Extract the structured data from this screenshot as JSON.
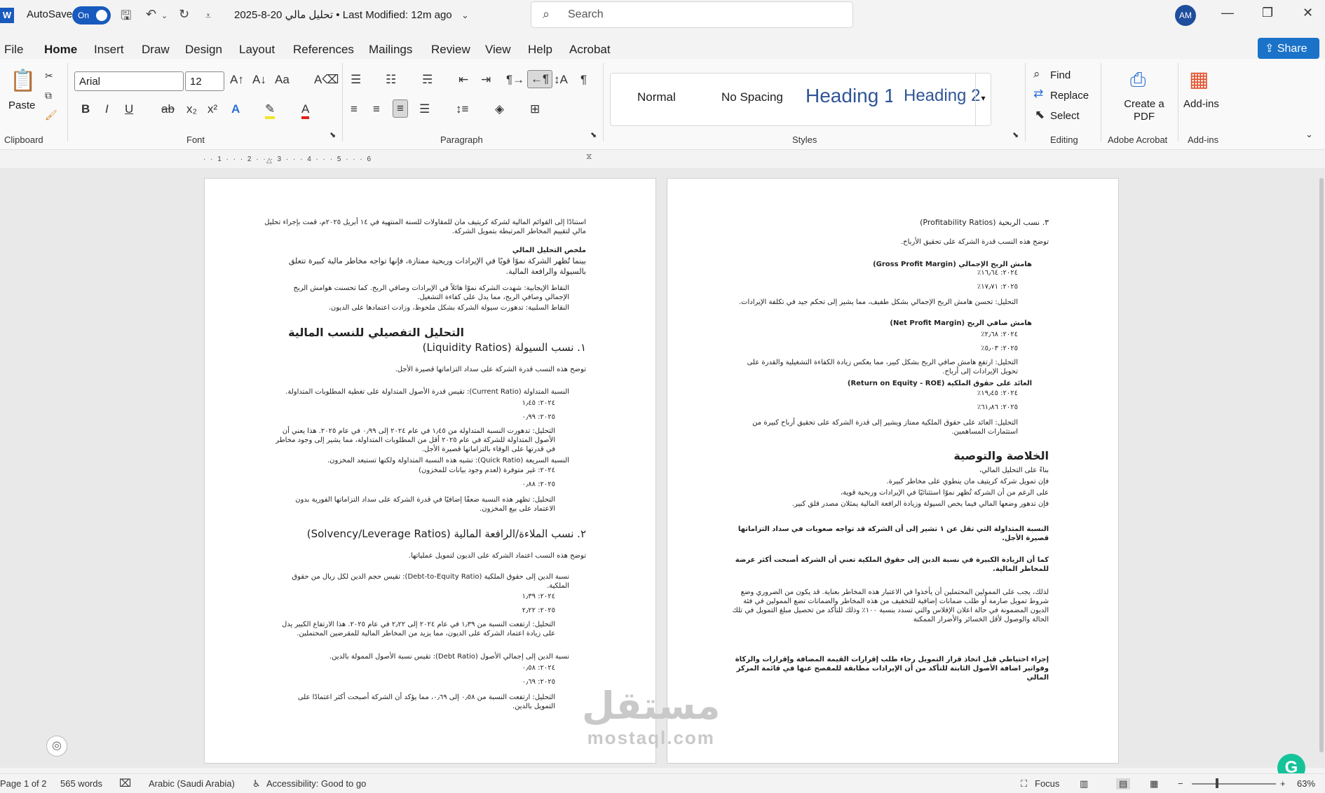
{
  "titlebar": {
    "app_icon": "W",
    "autosave_label": "AutoSave",
    "autosave_state": "On",
    "doc_title": "تحليل مالي 20-8-2025 • Last Modified: 12m ago",
    "search_placeholder": "Search",
    "avatar_initials": "AM"
  },
  "menu": {
    "items": [
      "File",
      "Home",
      "Insert",
      "Draw",
      "Design",
      "Layout",
      "References",
      "Mailings",
      "Review",
      "View",
      "Help",
      "Acrobat"
    ],
    "share_label": "Share"
  },
  "ribbon": {
    "paste_label": "Paste",
    "clipboard_label": "Clipboard",
    "font_name": "Arial",
    "font_size": "12",
    "font_label": "Font",
    "paragraph_label": "Paragraph",
    "styles": [
      "Normal",
      "No Spacing",
      "Heading 1",
      "Heading 2"
    ],
    "styles_label": "Styles",
    "find_label": "Find",
    "replace_label": "Replace",
    "select_label": "Select",
    "editing_label": "Editing",
    "create_pdf_label": "Create a PDF",
    "adobe_label": "Adobe Acrobat",
    "addins_label": "Add-ins",
    "addins_group_label": "Add-ins"
  },
  "ruler": {
    "marks": "· · 1 · · · 2 · · · 3 · · · 4 · · · 5 · · · 6"
  },
  "left_page": {
    "intro": "استنادًا إلى القوائم المالية لشركة كريتيف مان للمقاولات للسنة المنتهية في ١٤ أبريل ٢٠٢٥م، قمت بإجراء تحليل مالي لتقييم المخاطر المرتبطة بتمويل الشركة.",
    "summary_title": "ملخص التحليل المالي",
    "summary_text": "بينما تُظهر الشركة نموًا قويًا في الإيرادات وربحية ممتازة، فإنها تواجه مخاطر مالية كبيرة تتعلق بالسيولة والرافعة المالية.",
    "positive": "النقاط الإيجابية: شهدت الشركة نموًا هائلاً في الإيرادات وصافي الربح. كما تحسنت هوامش الربح الإجمالي وصافي الربح، مما يدل على كفاءة التشغيل.",
    "negative": "النقاط السلبية: تدهورت سيولة الشركة بشكل ملحوظ، وزادت اعتمادها على الديون.",
    "detail_title": "التحليل التفصيلي للنسب المالية",
    "liq_title": "١. نسب السيولة (Liquidity Ratios)",
    "liq_desc": "توضح هذه النسب قدرة الشركة على سداد التزاماتها قصيرة الأجل.",
    "current_ratio": "النسبة المتداولة (Current Ratio): تقيس قدرة الأصول المتداولة على تغطية المطلوبات المتداولة.",
    "cr_2024": "٢٠٢٤: ١٫٤٥",
    "cr_2025": "٢٠٢٥: ٠٫٩٩",
    "cr_analysis": "التحليل: تدهورت النسبة المتداولة من ١٫٤٥ في عام ٢٠٢٤ إلى ٠٫٩٩ في عام ٢٠٢٥. هذا يعني أن الأصول المتداولة للشركة في عام ٢٠٢٥ أقل من المطلوبات المتداولة، مما يشير إلى وجود مخاطر في قدرتها على الوفاء بالتزاماتها قصيرة الأجل.",
    "quick_ratio": "النسبة السريعة (Quick Ratio): تشبه هذه النسبة المتداولة ولكنها تستبعد المخزون.",
    "qr_2024": "٢٠٢٤: غير متوفرة (لعدم وجود بيانات للمخزون)",
    "qr_2025": "٢٠٢٥: ٠٫٨٨",
    "qr_analysis": "التحليل: تظهر هذه النسبة ضعفًا إضافيًا في قدرة الشركة على سداد التزاماتها الفورية بدون الاعتماد على بيع المخزون.",
    "solv_title": "٢. نسب الملاءة/الرافعة المالية (Solvency/Leverage Ratios)",
    "solv_desc": "توضح هذه النسب اعتماد الشركة على الديون لتمويل عملياتها.",
    "de_ratio": "نسبة الدين إلى حقوق الملكية (Debt-to-Equity Ratio): تقيس حجم الدين لكل ريال من حقوق الملكية.",
    "de_2024": "٢٠٢٤: ١٫٣٩",
    "de_2025": "٢٠٢٥: ٢٫٢٢",
    "de_analysis": "التحليل: ارتفعت النسبة من ١٫٣٩ في عام ٢٠٢٤ إلى ٢٫٢٢ في عام ٢٠٢٥. هذا الارتفاع الكبير يدل على زيادة اعتماد الشركة على الديون، مما يزيد من المخاطر المالية للمقرضين المحتملين.",
    "debt_ratio": "نسبة الدين إلى إجمالي الأصول (Debt Ratio): تقيس نسبة الأصول الممولة بالدين.",
    "dr_2024": "٢٠٢٤: ٠٫٥٨",
    "dr_2025": "٢٠٢٥: ٠٫٦٩",
    "dr_analysis": "التحليل: ارتفعت النسبة من ٠٫٥٨ إلى ٠٫٦٩، مما يؤكد أن الشركة أصبحت أكثر اعتمادًا على التمويل بالدين."
  },
  "right_page": {
    "prof_title": "٣. نسب الربحية (Profitability Ratios)",
    "prof_desc": "توضح هذه النسب قدرة الشركة على تحقيق الأرباح.",
    "gpm": "هامش الربح الإجمالي (Gross Profit Margin)",
    "gpm_2024": "٢٠٢٤: ١٦٫٦٤٪",
    "gpm_2025": "٢٠٢٥: ١٧٫٧١٪",
    "gpm_analysis": "التحليل: تحسن هامش الربح الإجمالي بشكل طفيف، مما يشير إلى تحكم جيد في تكلفة الإيرادات.",
    "npm": "هامش صافي الربح (Net Profit Margin)",
    "npm_2024": "٢٠٢٤: ٢٫٦٨٪",
    "npm_2025": "٢٠٢٥: ٥٫٠٣٪",
    "npm_analysis": "التحليل: ارتفع هامش صافي الربح بشكل كبير، مما يعكس زيادة الكفاءة التشغيلية والقدرة على تحويل الإيرادات إلى أرباح.",
    "roe": "العائد على حقوق الملكية (Return on Equity - ROE)",
    "roe_2024": "٢٠٢٤: ١٩٫٤٥٪",
    "roe_2025": "٢٠٢٥: ٦١٫٨٦٪",
    "roe_analysis": "التحليل: العائد على حقوق الملكية ممتاز ويشير إلى قدرة الشركة على تحقيق أرباح كبيرة من استثمارات المساهمين.",
    "concl_title": "الخلاصة والتوصية",
    "concl_1": "بناءً على التحليل المالي،",
    "concl_2": "فإن تمويل شركة كريتيف مان ينطوي على مخاطر كبيرة.",
    "concl_3": "على الرغم من أن الشركة تُظهر نموًا استثنائيًا في الإيرادات وربحية قوية،",
    "concl_4": "فإن تدهور وضعها المالي فيما يخص السيولة وزيادة الرافعة المالية يمثلان مصدر قلق كبير.",
    "concl_5": "النسبة المتداولة التي تقل عن ١ تشير إلى أن الشركة قد تواجه صعوبات في سداد التزاماتها قصيرة الأجل.",
    "concl_6": "كما أن الزيادة الكبيرة في نسبة الدين إلى حقوق الملكية تعني أن الشركة أصبحت أكثر عرضة للمخاطر المالية.",
    "concl_7": "لذلك، يجب على الممولين المحتملين أن يأخذوا في الاعتبار هذه المخاطر بعناية. قد يكون من الضروري وضع شروط تمويل صارمة أو طلب ضمانات إضافية للتخفيف من هذه المخاطر والضمانات تضع الممولين في فئة الديون المضمونة في حالة اعلان الإفلاس والتي تسدد بنسبة ١٠٠٪ وذلك للتأكد من تحصيل مبلغ التمويل في تلك الحالة والوصول لأقل الخسائر والأضرار الممكنة",
    "concl_8": "إجراء احتياطي قبل اتخاذ قرار التمويل رجاء طلب إقرارات القيمة المضافة وإقرارات والزكاة وفواتير اضافة الأصول الثابتة للتأكد من أن الإيرادات مطابقة للمفصح عنها في قائمة المركز المالي"
  },
  "watermark": {
    "arabic": "مستقل",
    "latin": "mostaql.com"
  },
  "status": {
    "page": "Page 1 of 2",
    "words": "565 words",
    "language": "Arabic (Saudi Arabia)",
    "accessibility": "Accessibility: Good to go",
    "focus": "Focus",
    "zoom": "63%"
  }
}
